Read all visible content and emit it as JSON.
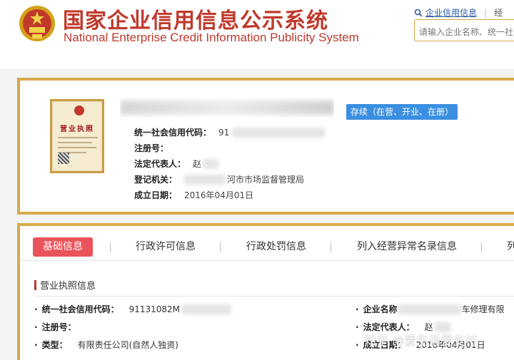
{
  "header": {
    "title_cn": "国家企业信用信息公示系统",
    "title_en": "National Enterprise Credit Information Publicity System",
    "top_link": "企业信用信息",
    "top_link_more": "经",
    "search_placeholder": "请输入企业名称、统一社"
  },
  "company": {
    "status": "存续（在营、开业、在册）",
    "fields": [
      {
        "label": "统一社会信用代码：",
        "value": "91"
      },
      {
        "label": "注册号：",
        "value": ""
      },
      {
        "label": "法定代表人：",
        "value": "赵"
      },
      {
        "label": "登记机关：",
        "value": "河市市场监督管理局"
      },
      {
        "label": "成立日期：",
        "value": "2016年04月01日"
      }
    ],
    "license": {
      "title": "营业执照"
    }
  },
  "tabs": [
    {
      "label": "基础信息",
      "active": true
    },
    {
      "label": "行政许可信息",
      "active": false
    },
    {
      "label": "行政处罚信息",
      "active": false
    },
    {
      "label": "列入经营异常名录信息",
      "active": false
    },
    {
      "label": "列",
      "active": false
    }
  ],
  "section": {
    "title": "营业执照信息",
    "left_rows": [
      {
        "label": "统一社会信用代码：",
        "value": "91131082M"
      },
      {
        "label": "注册号：",
        "value": ""
      },
      {
        "label": "类型：",
        "value": "有限责任公司(自然人独资)"
      }
    ],
    "right_rows": [
      {
        "label": "企业名称",
        "value": "车修理有限"
      },
      {
        "label": "法定代表人：",
        "value": "赵"
      },
      {
        "label": "成立日期：",
        "value": "2016年04月01日"
      }
    ]
  },
  "watermark": "知乎 @爱生活爱支付"
}
